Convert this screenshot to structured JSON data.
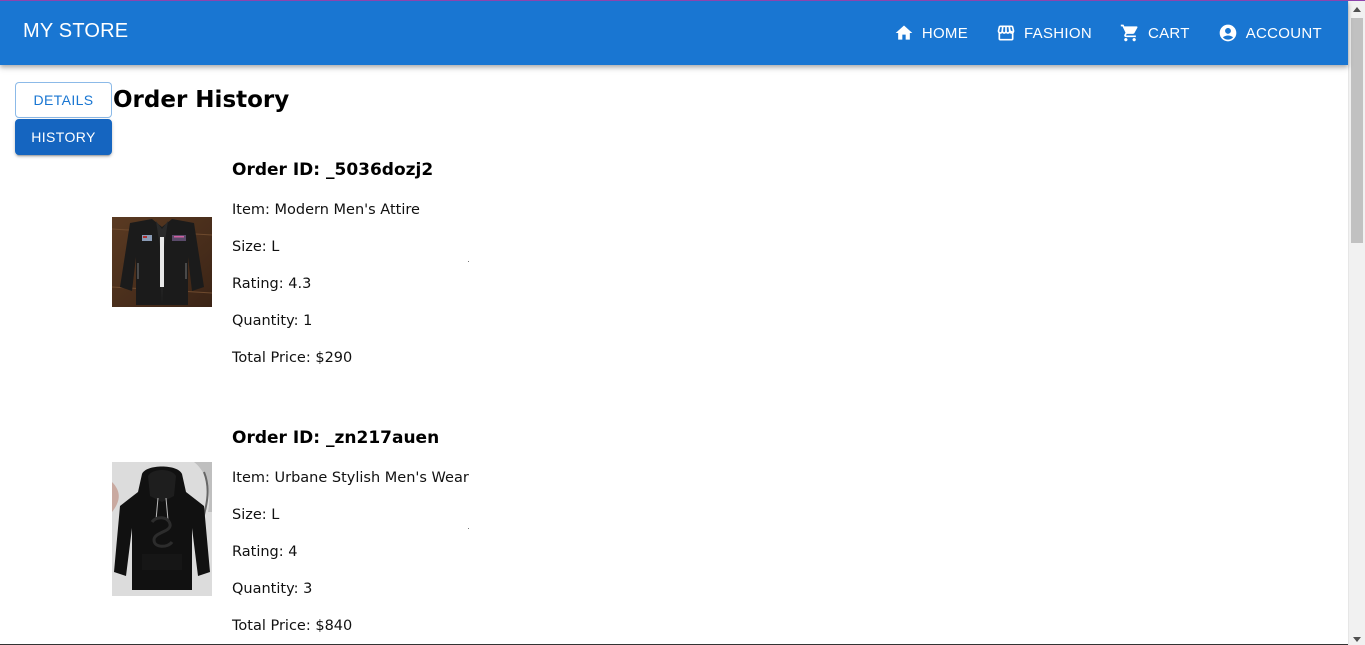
{
  "appbar": {
    "brand": "MY STORE",
    "nav": [
      {
        "label": "HOME",
        "icon": "home-icon"
      },
      {
        "label": "FASHION",
        "icon": "storefront-icon"
      },
      {
        "label": "CART",
        "icon": "cart-icon"
      },
      {
        "label": "ACCOUNT",
        "icon": "account-circle-icon"
      }
    ],
    "color": "#1976d2"
  },
  "tabs": {
    "details_label": "DETAILS",
    "history_label": "HISTORY"
  },
  "page_title": "Order History",
  "orders": [
    {
      "id_text": "Order ID: _5036dozj2",
      "item_text": "Item: Modern Men's Attire",
      "size_text": "Size: L",
      "rating_text": "Rating: 4.3",
      "quantity_text": "Quantity: 1",
      "price_text": "Total Price: $290"
    },
    {
      "id_text": "Order ID: _zn217auen",
      "item_text": "Item: Urbane Stylish Men's Wear",
      "size_text": "Size: L",
      "rating_text": "Rating: 4",
      "quantity_text": "Quantity: 3",
      "price_text": "Total Price: $840"
    }
  ]
}
